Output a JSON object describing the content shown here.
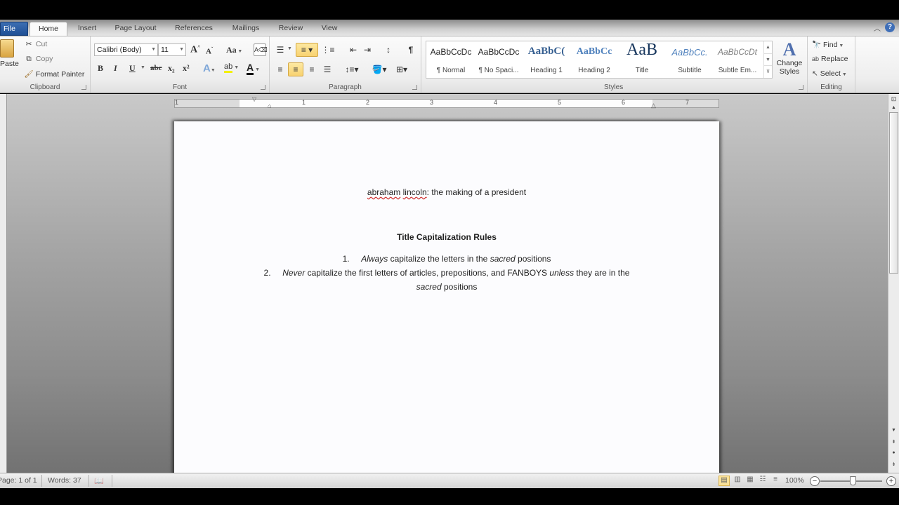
{
  "tabs": [
    {
      "label": "File"
    },
    {
      "label": "Home"
    },
    {
      "label": "Insert"
    },
    {
      "label": "Page Layout"
    },
    {
      "label": "References"
    },
    {
      "label": "Mailings"
    },
    {
      "label": "Review"
    },
    {
      "label": "View"
    }
  ],
  "active_tab": "Home",
  "clipboard": {
    "label": "Clipboard",
    "paste": "Paste",
    "cut": "Cut",
    "copy": "Copy",
    "format_painter": "Format Painter"
  },
  "font": {
    "label": "Font",
    "font_name": "Calibri (Body)",
    "font_size": "11",
    "grow": "A",
    "shrink": "A",
    "change_case": "Aa",
    "bold": "B",
    "italic": "I",
    "underline": "U",
    "strikethrough": "abc",
    "subscript": "x₂",
    "superscript": "x²",
    "font_color": "A"
  },
  "paragraph": {
    "label": "Paragraph",
    "active_buttons": [
      "numbering",
      "center"
    ]
  },
  "styles": {
    "label": "Styles",
    "items": [
      {
        "preview": "AaBbCcDc",
        "name": "¶ Normal"
      },
      {
        "preview": "AaBbCcDc",
        "name": "¶ No Spaci..."
      },
      {
        "preview": "AaBbC(",
        "name": "Heading 1"
      },
      {
        "preview": "AaBbCc",
        "name": "Heading 2"
      },
      {
        "preview": "AaB",
        "name": "Title"
      },
      {
        "preview": "AaBbCc.",
        "name": "Subtitle"
      },
      {
        "preview": "AaBbCcDt",
        "name": "Subtle Em..."
      }
    ],
    "change_styles": "Change Styles"
  },
  "editing": {
    "label": "Editing",
    "find": "Find",
    "replace": "Replace",
    "select": "Select"
  },
  "ruler": {
    "numbers": [
      "1",
      "1",
      "2",
      "3",
      "4",
      "5",
      "6",
      "7"
    ]
  },
  "document": {
    "line1_misspelled_1": "abraham",
    "line1_misspelled_2": "lincoln",
    "line1_rest": ": the making of a president",
    "heading": "Title Capitalization Rules",
    "list": [
      {
        "num": "1.",
        "parts": [
          {
            "text": "Always",
            "italic": true
          },
          {
            "text": " capitalize the letters in the ",
            "italic": false
          },
          {
            "text": "sacred",
            "italic": true
          },
          {
            "text": " positions",
            "italic": false
          }
        ]
      },
      {
        "num": "2.",
        "parts": [
          {
            "text": "Never",
            "italic": true
          },
          {
            "text": " capitalize the first letters of articles, prepositions, and FANBOYS ",
            "italic": false
          },
          {
            "text": "unless",
            "italic": true
          },
          {
            "text": " they are in the",
            "italic": false
          }
        ],
        "continuation": [
          {
            "text": "sacred",
            "italic": true
          },
          {
            "text": " positions",
            "italic": false
          }
        ]
      }
    ]
  },
  "status": {
    "page": "Page: 1 of 1",
    "words": "Words: 37",
    "zoom": "100%",
    "zoom_fraction": 0.5
  },
  "colors": {
    "file_tab": "#2a5aa0",
    "highlight_button": "#f8d270",
    "spell_underline": "#d03030"
  }
}
